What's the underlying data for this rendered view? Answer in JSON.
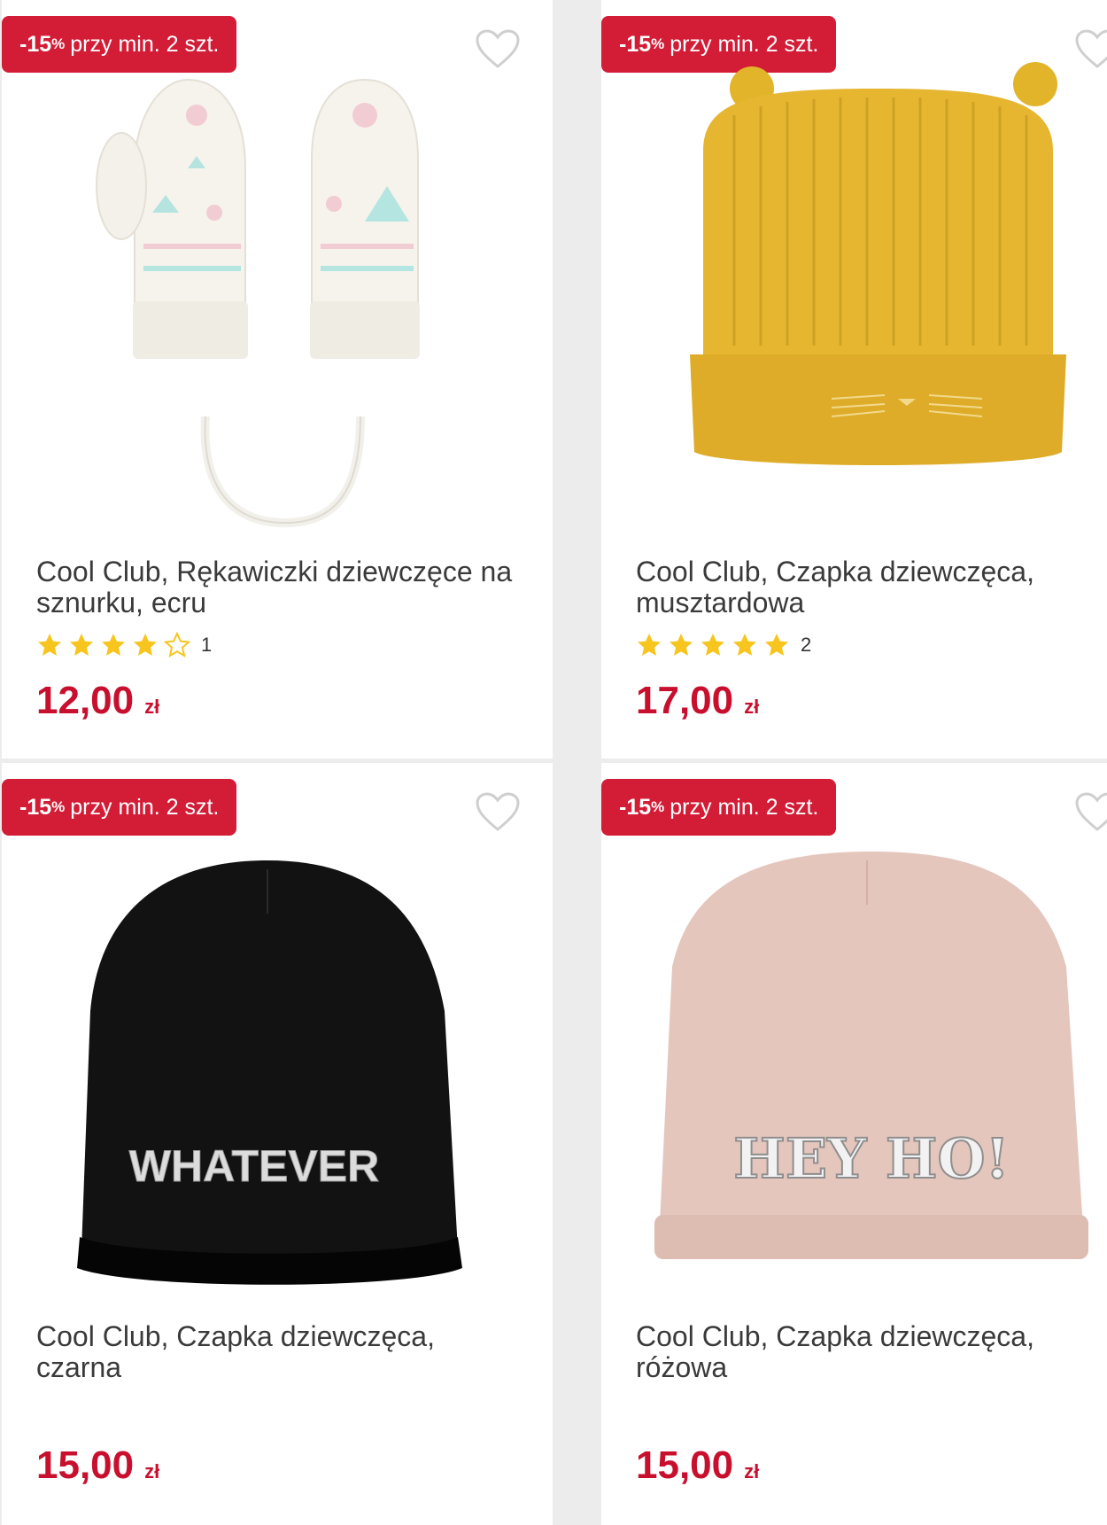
{
  "colors": {
    "accent": "#c8102e",
    "badge": "#d31c36",
    "star": "#f7c51e"
  },
  "products": [
    {
      "promo": {
        "pct": "-15",
        "sym": "%",
        "text": "przy min. 2 szt."
      },
      "title": "Cool Club, Rękawiczki dziewczęce na sznurku, ecru",
      "rating": {
        "stars": 4,
        "max": 5,
        "count": "1"
      },
      "price": {
        "amount": "12,00",
        "currency": "zł"
      },
      "image": "mittens"
    },
    {
      "promo": {
        "pct": "-15",
        "sym": "%",
        "text": "przy min. 2 szt."
      },
      "title": "Cool Club, Czapka dziewczęca, musztardowa",
      "rating": {
        "stars": 5,
        "max": 5,
        "count": "2"
      },
      "price": {
        "amount": "17,00",
        "currency": "zł"
      },
      "image": "yellow-hat"
    },
    {
      "promo": {
        "pct": "-15",
        "sym": "%",
        "text": "przy min. 2 szt."
      },
      "title": "Cool Club, Czapka dziewczęca, czarna",
      "price": {
        "amount": "15,00",
        "currency": "zł"
      },
      "image": "black-hat",
      "image_text": "WHATEVER"
    },
    {
      "promo": {
        "pct": "-15",
        "sym": "%",
        "text": "przy min. 2 szt."
      },
      "title": "Cool Club, Czapka dziewczęca, różowa",
      "price": {
        "amount": "15,00",
        "currency": "zł"
      },
      "image": "pink-hat",
      "image_text": "HEY HO!"
    }
  ]
}
